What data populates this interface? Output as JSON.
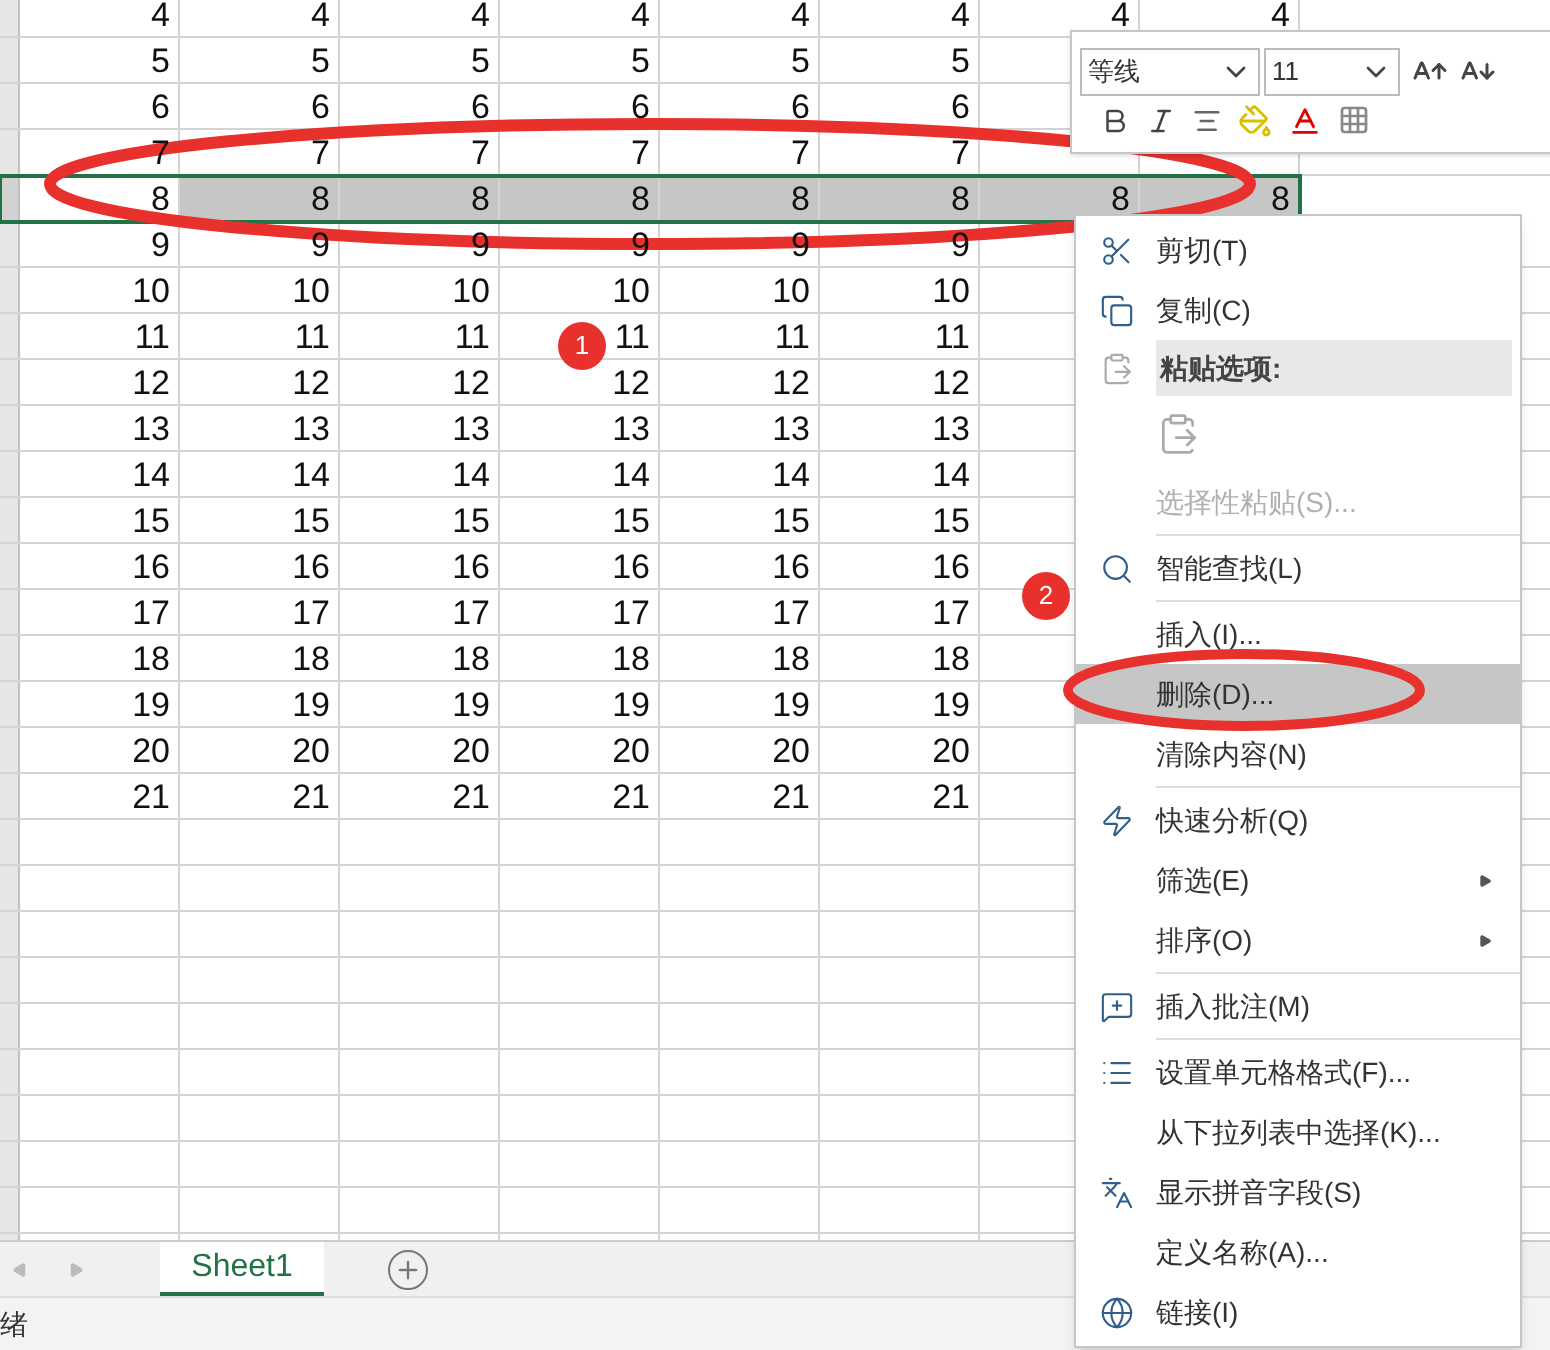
{
  "sheet": {
    "rows": [
      {
        "selected": false,
        "cells": [
          "4",
          "4",
          "4",
          "4",
          "4",
          "4",
          "4",
          "4"
        ]
      },
      {
        "selected": false,
        "cells": [
          "5",
          "5",
          "5",
          "5",
          "5",
          "5"
        ]
      },
      {
        "selected": false,
        "cells": [
          "6",
          "6",
          "6",
          "6",
          "6",
          "6"
        ]
      },
      {
        "selected": false,
        "cells": [
          "7",
          "7",
          "7",
          "7",
          "7",
          "7"
        ]
      },
      {
        "selected": true,
        "cells": [
          "8",
          "8",
          "8",
          "8",
          "8",
          "8",
          "8",
          "8"
        ]
      },
      {
        "selected": false,
        "cells": [
          "9",
          "9",
          "9",
          "9",
          "9",
          "9"
        ]
      },
      {
        "selected": false,
        "cells": [
          "10",
          "10",
          "10",
          "10",
          "10",
          "10"
        ]
      },
      {
        "selected": false,
        "cells": [
          "11",
          "11",
          "11",
          "11",
          "11",
          "11"
        ]
      },
      {
        "selected": false,
        "cells": [
          "12",
          "12",
          "12",
          "12",
          "12",
          "12"
        ]
      },
      {
        "selected": false,
        "cells": [
          "13",
          "13",
          "13",
          "13",
          "13",
          "13"
        ]
      },
      {
        "selected": false,
        "cells": [
          "14",
          "14",
          "14",
          "14",
          "14",
          "14"
        ]
      },
      {
        "selected": false,
        "cells": [
          "15",
          "15",
          "15",
          "15",
          "15",
          "15"
        ]
      },
      {
        "selected": false,
        "cells": [
          "16",
          "16",
          "16",
          "16",
          "16",
          "16"
        ]
      },
      {
        "selected": false,
        "cells": [
          "17",
          "17",
          "17",
          "17",
          "17",
          "17"
        ]
      },
      {
        "selected": false,
        "cells": [
          "18",
          "18",
          "18",
          "18",
          "18",
          "18"
        ]
      },
      {
        "selected": false,
        "cells": [
          "19",
          "19",
          "19",
          "19",
          "19",
          "19"
        ]
      },
      {
        "selected": false,
        "cells": [
          "20",
          "20",
          "20",
          "20",
          "20",
          "20"
        ]
      },
      {
        "selected": false,
        "cells": [
          "21",
          "21",
          "21",
          "21",
          "21",
          "21"
        ]
      }
    ]
  },
  "mini_toolbar": {
    "font": "等线",
    "size": "11"
  },
  "context_menu": [
    {
      "kind": "item",
      "label": "剪切(T)",
      "disabled": false,
      "selected": false
    },
    {
      "kind": "item",
      "label": "复制(C)",
      "disabled": false,
      "selected": false
    },
    {
      "kind": "header",
      "label": "粘贴选项:"
    },
    {
      "kind": "paste_option"
    },
    {
      "kind": "item",
      "label": "选择性粘贴(S)...",
      "disabled": true,
      "selected": false
    },
    {
      "kind": "separator"
    },
    {
      "kind": "item",
      "label": "智能查找(L)",
      "disabled": false,
      "selected": false
    },
    {
      "kind": "separator"
    },
    {
      "kind": "item",
      "label": "插入(I)...",
      "disabled": false,
      "selected": false
    },
    {
      "kind": "item",
      "label": "删除(D)...",
      "disabled": false,
      "selected": true
    },
    {
      "kind": "item",
      "label": "清除内容(N)",
      "disabled": false,
      "selected": false
    },
    {
      "kind": "separator"
    },
    {
      "kind": "item",
      "label": "快速分析(Q)",
      "disabled": false,
      "selected": false
    },
    {
      "kind": "submenu",
      "label": "筛选(E)",
      "disabled": false,
      "selected": false
    },
    {
      "kind": "submenu",
      "label": "排序(O)",
      "disabled": false,
      "selected": false
    },
    {
      "kind": "separator"
    },
    {
      "kind": "item",
      "label": "插入批注(M)",
      "disabled": false,
      "selected": false
    },
    {
      "kind": "separator"
    },
    {
      "kind": "item",
      "label": "设置单元格格式(F)...",
      "disabled": false,
      "selected": false
    },
    {
      "kind": "item",
      "label": "从下拉列表中选择(K)...",
      "disabled": false,
      "selected": false
    },
    {
      "kind": "item",
      "label": "显示拼音字段(S)",
      "disabled": false,
      "selected": false
    },
    {
      "kind": "item",
      "label": "定义名称(A)...",
      "disabled": false,
      "selected": false
    },
    {
      "kind": "item",
      "label": "链接(I)",
      "disabled": false,
      "selected": false
    }
  ],
  "annotations": [
    {
      "label": "1"
    },
    {
      "label": "2"
    }
  ],
  "sheet_tabs": [
    {
      "label": "Sheet1",
      "selected": true
    }
  ],
  "status_bar": {
    "text": "绪"
  }
}
